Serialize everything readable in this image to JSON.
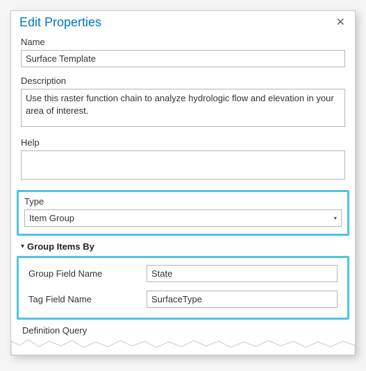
{
  "dialog": {
    "title": "Edit Properties",
    "close_glyph": "✕"
  },
  "fields": {
    "name_label": "Name",
    "name_value": "Surface Template",
    "desc_label": "Description",
    "desc_value": "Use this raster function chain to analyze hydrologic flow and elevation in your area of interest.",
    "help_label": "Help",
    "help_value": ""
  },
  "type_section": {
    "label": "Type",
    "value": "Item Group",
    "caret": "▾"
  },
  "group_section": {
    "caret": "⯆",
    "title": "Group Items By",
    "group_field_label": "Group Field Name",
    "group_field_value": "State",
    "tag_field_label": "Tag Field Name",
    "tag_field_value": "SurfaceType"
  },
  "defq": {
    "label": "Definition Query"
  }
}
